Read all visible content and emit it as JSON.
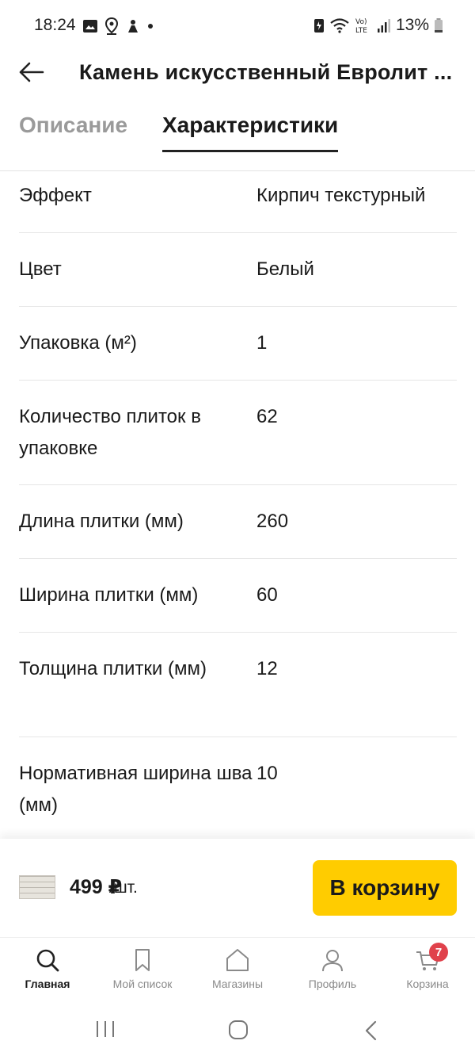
{
  "status_bar": {
    "time": "18:24",
    "battery": "13%",
    "network": "Vo) LTE"
  },
  "header": {
    "title": "Камень искусственный Евролит ..."
  },
  "tabs": [
    {
      "label": "Описание",
      "active": false
    },
    {
      "label": "Характеристики",
      "active": true
    }
  ],
  "specs": [
    {
      "label": "Эффект",
      "value": "Кирпич текстурный"
    },
    {
      "label": "Цвет",
      "value": "Белый"
    },
    {
      "label": "Упаковка (м²)",
      "value": "1"
    },
    {
      "label": "Количество плиток в упаковке",
      "value": "62"
    },
    {
      "label": "Длина плитки (мм)",
      "value": "260"
    },
    {
      "label": "Ширина плитки (мм)",
      "value": "60"
    },
    {
      "label": "Толщина плитки (мм)",
      "value": "12"
    },
    {
      "label": "Нормативная ширина шва (мм)",
      "value": "10"
    }
  ],
  "buy_bar": {
    "price": "499 ₽",
    "unit": "/шт.",
    "button_label": "В корзину"
  },
  "bottom_nav": [
    {
      "label": "Главная",
      "icon": "search-icon",
      "active": true
    },
    {
      "label": "Мой список",
      "icon": "bookmark-icon",
      "active": false
    },
    {
      "label": "Магазины",
      "icon": "home-icon",
      "active": false
    },
    {
      "label": "Профиль",
      "icon": "user-icon",
      "active": false
    },
    {
      "label": "Корзина",
      "icon": "cart-icon",
      "active": false,
      "badge": "7"
    }
  ],
  "colors": {
    "accent": "#ffcc00",
    "badge": "#e0414b"
  }
}
